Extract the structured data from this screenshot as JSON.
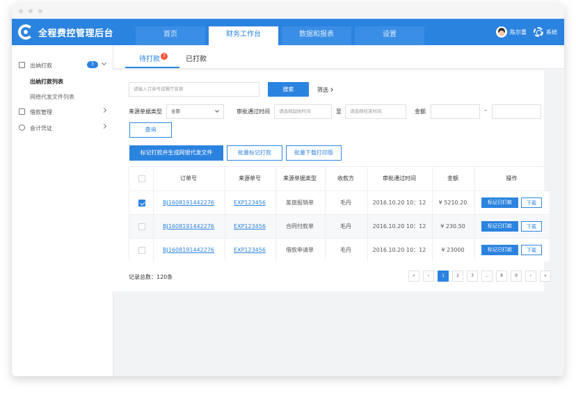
{
  "header": {
    "app_title": "全程费控管理后台",
    "tabs": [
      {
        "label": "首页"
      },
      {
        "label": "财务工作台"
      },
      {
        "label": "数据和报表"
      },
      {
        "label": "设置"
      }
    ],
    "user_name": "陈尔重",
    "system_label": "系统"
  },
  "sidebar": {
    "items": [
      {
        "label": "出纳打款",
        "badge": "3",
        "icon": "cashier-icon"
      },
      {
        "label": "借款管理",
        "icon": "loan-icon"
      },
      {
        "label": "会计凭证",
        "icon": "voucher-icon"
      }
    ],
    "sub_items": [
      {
        "label": "出纳打款列表"
      },
      {
        "label": "网络代发文件列表"
      }
    ]
  },
  "subtabs": {
    "pending_label": "待打款",
    "pending_badge": "3",
    "done_label": "已打款"
  },
  "filters": {
    "search_placeholder": "请输入订单号或餐厅名称",
    "search_button": "搜索",
    "filter_toggle": "筛选",
    "source_type_label": "来源单据类型",
    "source_type_value": "全部",
    "approval_time_label": "审批通过时间",
    "start_placeholder": "请选择起始时间",
    "to_label": "至",
    "end_placeholder": "请选择结束时间",
    "amount_label": "金额",
    "amount_dash": "–",
    "query_button": "查询"
  },
  "actions": {
    "mark_generate": "标记打款并生成网银代发文件",
    "batch_mark": "批量标记打款",
    "batch_download": "批量下载打印版"
  },
  "table": {
    "headers": [
      "订单号",
      "来源单号",
      "来源单据类型",
      "收款方",
      "审批通过时间",
      "金额",
      "操作"
    ],
    "rows": [
      {
        "checked": true,
        "order": "BJ1608191442276",
        "source": "EXP123456",
        "type": "差旅报销单",
        "payee": "毛丹",
        "time": "2016.10.20 10：12",
        "amount": "¥ 5210.20",
        "mark": "标记已打款",
        "download": "下载"
      },
      {
        "checked": false,
        "order": "BJ1608191442276",
        "source": "EXP123456",
        "type": "合同付款单",
        "payee": "毛丹",
        "time": "2016.10.20 10：12",
        "amount": "¥ 230.50",
        "mark": "标记已打款",
        "download": "下载"
      },
      {
        "checked": false,
        "order": "BJ1608191442276",
        "source": "EXP123456",
        "type": "借款申请单",
        "payee": "毛丹",
        "time": "2016.10.20 10：12",
        "amount": "¥ 23000",
        "mark": "标记已打款",
        "download": "下载"
      }
    ]
  },
  "footer": {
    "total_text": "记录总数：120条",
    "pager": [
      "«",
      "‹",
      "1",
      "2",
      "3",
      "...",
      "8",
      "9",
      "›",
      "»"
    ],
    "current_page": "1"
  },
  "colors": {
    "primary": "#2b83e0",
    "badge_red": "#f0533c"
  }
}
